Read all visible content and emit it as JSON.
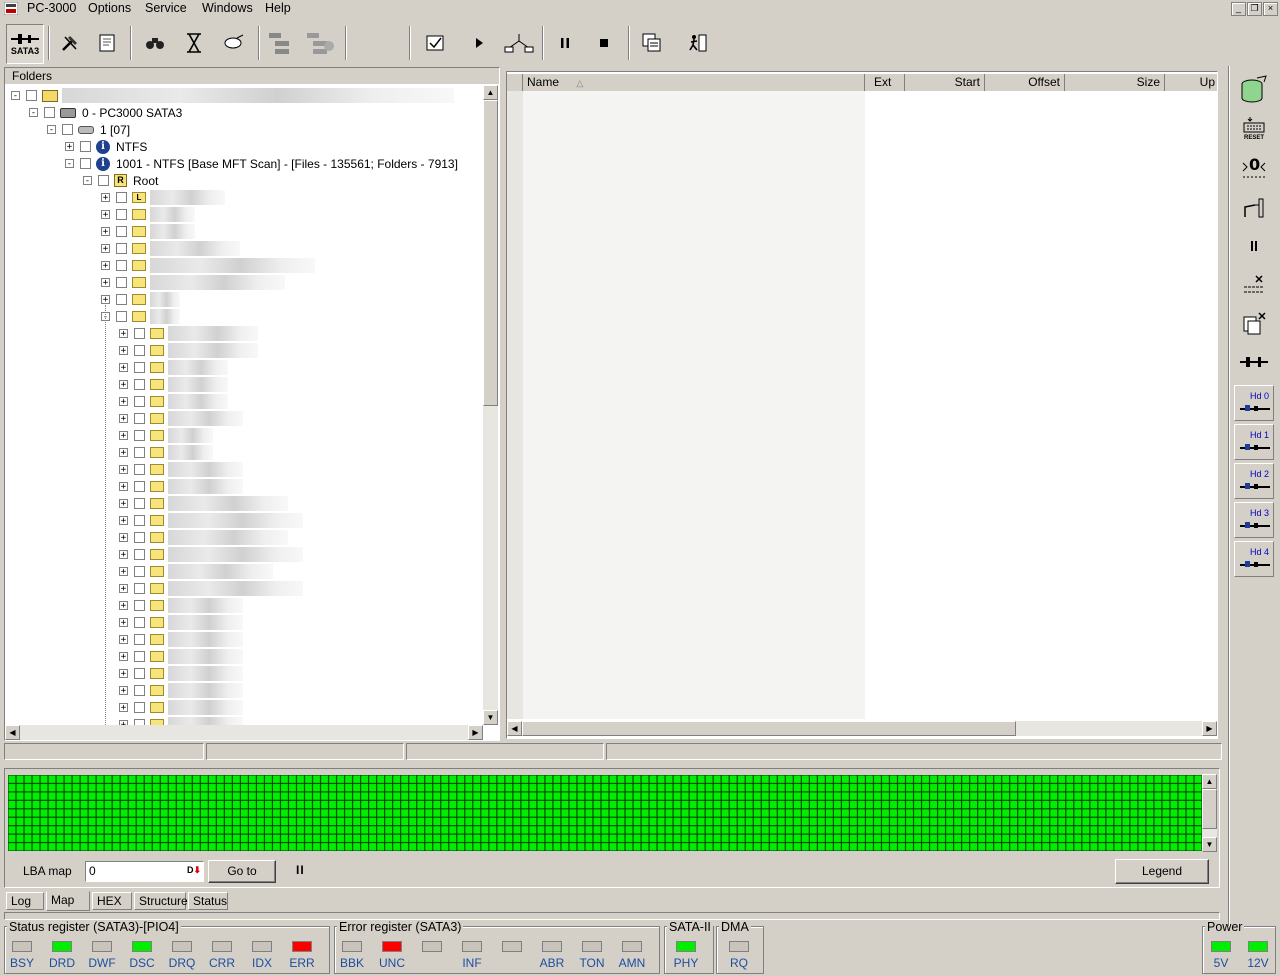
{
  "app": {
    "title": "PC-3000",
    "menu": [
      "Options",
      "Service",
      "Windows",
      "Help"
    ]
  },
  "toolbar": {
    "sata3_label": "SATA3",
    "icons": [
      "sata3-connector-icon",
      "tools-icon",
      "scroll-info-icon",
      "binoculars-icon",
      "hourglass-icon",
      "drive-stack-icon",
      "tree-list-icon",
      "tree-list-gray-icon",
      "checked-doc-icon",
      "play-icon",
      "network-icon",
      "pause-icon",
      "stop-icon",
      "copy-windows-icon",
      "exit-runner-icon"
    ]
  },
  "folders": {
    "header": "Folders",
    "device": "0 - PC3000 SATA3",
    "partition": "1 [07]",
    "ntfs": "NTFS",
    "scan": "1001 - NTFS [Base MFT Scan] - [Files - 135561; Folders - 7913]",
    "root_badge": "R",
    "root": "Root",
    "first_badge": "L"
  },
  "files": {
    "columns": [
      "Name",
      "Ext",
      "Start",
      "Offset",
      "Size",
      "Up"
    ],
    "sort_indicator": "△"
  },
  "map": {
    "lba_label": "LBA map",
    "lba_value": "0",
    "goto_label": "Go to",
    "pause_label": "II",
    "legend_label": "Legend",
    "block_color": "#00ee00"
  },
  "tabs": [
    "Log",
    "Map",
    "HEX",
    "Structure",
    "Status"
  ],
  "active_tab": "Map",
  "status_register": {
    "title": "Status register (SATA3)-[PIO4]",
    "leds": [
      {
        "label": "BSY",
        "color": "#c8c4bc"
      },
      {
        "label": "DRD",
        "color": "#00ee00"
      },
      {
        "label": "DWF",
        "color": "#c8c4bc"
      },
      {
        "label": "DSC",
        "color": "#00ee00"
      },
      {
        "label": "DRQ",
        "color": "#c8c4bc"
      },
      {
        "label": "CRR",
        "color": "#c8c4bc"
      },
      {
        "label": "IDX",
        "color": "#c8c4bc"
      },
      {
        "label": "ERR",
        "color": "#ff0000"
      }
    ]
  },
  "error_register": {
    "title": "Error register (SATA3)",
    "leds": [
      {
        "label": "BBK",
        "color": "#c8c4bc"
      },
      {
        "label": "UNC",
        "color": "#ff0000"
      },
      {
        "label": "",
        "color": "#c8c4bc"
      },
      {
        "label": "INF",
        "color": "#c8c4bc"
      },
      {
        "label": "",
        "color": "#c8c4bc"
      },
      {
        "label": "ABR",
        "color": "#c8c4bc"
      },
      {
        "label": "TON",
        "color": "#c8c4bc"
      },
      {
        "label": "AMN",
        "color": "#c8c4bc"
      }
    ]
  },
  "sata2": {
    "title": "SATA-II",
    "led": {
      "label": "PHY",
      "color": "#00ee00"
    }
  },
  "dma": {
    "title": "DMA",
    "led": {
      "label": "RQ",
      "color": "#c8c4bc"
    }
  },
  "power": {
    "title": "Power",
    "leds": [
      {
        "label": "5V",
        "color": "#00ee00"
      },
      {
        "label": "12V",
        "color": "#00ee00"
      }
    ]
  },
  "sidebar": {
    "reset_label": "RESET",
    "hd_labels": [
      "Hd 0",
      "Hd 1",
      "Hd 2",
      "Hd 3",
      "Hd 4"
    ]
  }
}
